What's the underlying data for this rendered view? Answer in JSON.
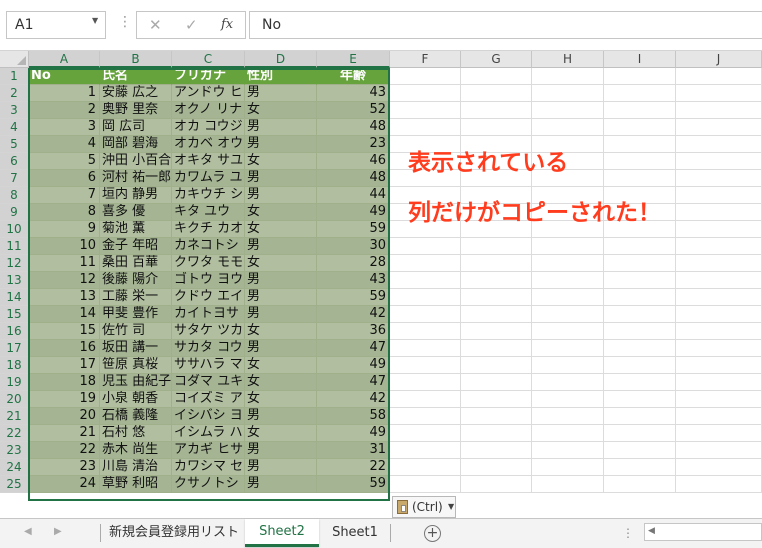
{
  "formula_bar": {
    "name_box": "A1",
    "cancel_icon": "✕",
    "enter_icon": "✓",
    "fx_label": "fx",
    "formula_value": "No"
  },
  "columns": [
    "A",
    "B",
    "C",
    "D",
    "E",
    "F",
    "G",
    "H",
    "I",
    "J"
  ],
  "row_numbers": [
    "1",
    "2",
    "3",
    "4",
    "5",
    "6",
    "7",
    "8",
    "9",
    "10",
    "11",
    "12",
    "13",
    "14",
    "15",
    "16",
    "17",
    "18",
    "19",
    "20",
    "21",
    "22",
    "23",
    "24",
    "25"
  ],
  "table": {
    "headers": [
      "No",
      "氏名",
      "フリガナ",
      "性別",
      "年齢"
    ],
    "rows": [
      [
        "1",
        "安藤 広之",
        "アンドウ ヒ",
        "男",
        "43"
      ],
      [
        "2",
        "奥野 里奈",
        "オクノ リナ",
        "女",
        "52"
      ],
      [
        "3",
        "岡 広司",
        "オカ コウジ",
        "男",
        "48"
      ],
      [
        "4",
        "岡部 碧海",
        "オカベ オウ",
        "男",
        "23"
      ],
      [
        "5",
        "沖田 小百合",
        "オキタ サユ",
        "女",
        "46"
      ],
      [
        "6",
        "河村 祐一郎",
        "カワムラ ユ",
        "男",
        "48"
      ],
      [
        "7",
        "垣内 静男",
        "カキウチ シ",
        "男",
        "44"
      ],
      [
        "8",
        "喜多 優",
        "キタ ユウ",
        "女",
        "49"
      ],
      [
        "9",
        "菊池 薫",
        "キクチ カオ",
        "女",
        "59"
      ],
      [
        "10",
        "金子 年昭",
        "カネコトシ",
        "男",
        "30"
      ],
      [
        "11",
        "桑田 百華",
        "クワタ モモ",
        "女",
        "28"
      ],
      [
        "12",
        "後藤 陽介",
        "ゴトウ ヨウ",
        "男",
        "43"
      ],
      [
        "13",
        "工藤 栄一",
        "クドウ エイ",
        "男",
        "59"
      ],
      [
        "14",
        "甲斐 豊作",
        "カイトヨサ",
        "男",
        "42"
      ],
      [
        "15",
        "佐竹 司",
        "サタケ ツカ",
        "女",
        "36"
      ],
      [
        "16",
        "坂田 講一",
        "サカタ コウ",
        "男",
        "47"
      ],
      [
        "17",
        "笹原 真桜",
        "ササハラ マ",
        "女",
        "49"
      ],
      [
        "18",
        "児玉 由紀子",
        "コダマ ユキ",
        "女",
        "47"
      ],
      [
        "19",
        "小泉 朝香",
        "コイズミ ア",
        "女",
        "42"
      ],
      [
        "20",
        "石橋 義隆",
        "イシバシ ヨ",
        "男",
        "58"
      ],
      [
        "21",
        "石村 悠",
        "イシムラ ハ",
        "女",
        "49"
      ],
      [
        "22",
        "赤木 尚生",
        "アカギ ヒサ",
        "男",
        "31"
      ],
      [
        "23",
        "川島 清治",
        "カワシマ セ",
        "男",
        "22"
      ],
      [
        "24",
        "草野 利昭",
        "クサノトシ",
        "男",
        "59"
      ]
    ]
  },
  "annotation": {
    "line1": "表示されている",
    "line2": "列だけがコピーされた！"
  },
  "paste_options": {
    "label": "(Ctrl)"
  },
  "sheet_tabs": {
    "tabs": [
      "新規会員登録用リスト",
      "Sheet2",
      "Sheet1"
    ],
    "active": "Sheet2",
    "add_label": "+",
    "menu_dots": "⋮"
  },
  "colors": {
    "header_fill": "#66a33c",
    "row_fill_odd": "#b1bfa0",
    "row_fill_even": "#a5b594",
    "selection_border": "#217346",
    "annotation_text": "#ff3c1e"
  }
}
